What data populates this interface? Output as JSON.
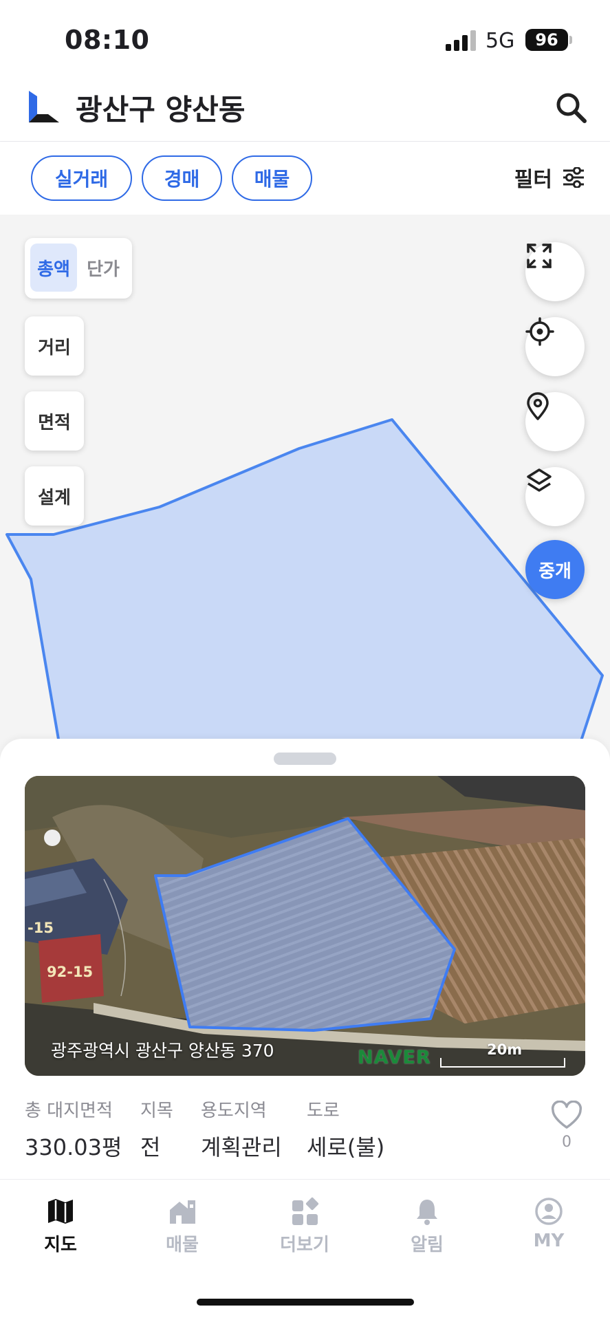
{
  "status_bar": {
    "time": "08:10",
    "network": "5G",
    "battery": "96"
  },
  "header": {
    "title": "광산구 양산동",
    "logo_icon": "app-logo-icon",
    "search_icon": "search-icon"
  },
  "chips": [
    {
      "label": "실거래"
    },
    {
      "label": "경매"
    },
    {
      "label": "매물"
    }
  ],
  "filter": {
    "label": "필터",
    "icon": "filter-sliders-icon"
  },
  "map": {
    "price_toggle": {
      "selected": "총액",
      "other": "단가"
    },
    "tools": [
      {
        "label": "거리"
      },
      {
        "label": "면적"
      },
      {
        "label": "설계"
      }
    ],
    "fab_labels": {
      "broker": "중개"
    },
    "fab_icons": [
      "expand-icon",
      "crosshair-icon",
      "location-pin-icon",
      "layers-icon"
    ],
    "parcel_fill": "#c9d9f7",
    "parcel_stroke": "#4a86ef"
  },
  "parcel_card": {
    "address": "광주광역시 광산구 양산동 370",
    "map_brand": "NAVER",
    "scale": "20m",
    "neighbor_labels": [
      "-15",
      "92-15"
    ],
    "info": [
      {
        "label": "총 대지면적",
        "value": "330.03평"
      },
      {
        "label": "지목",
        "value": "전"
      },
      {
        "label": "용도지역",
        "value": "계획관리"
      },
      {
        "label": "도로",
        "value": "세로(불)"
      }
    ],
    "favorite_count": "0"
  },
  "tabbar": [
    {
      "label": "지도",
      "active": true
    },
    {
      "label": "매물",
      "active": false
    },
    {
      "label": "더보기",
      "active": false
    },
    {
      "label": "알림",
      "active": false
    },
    {
      "label": "MY",
      "active": false
    }
  ]
}
